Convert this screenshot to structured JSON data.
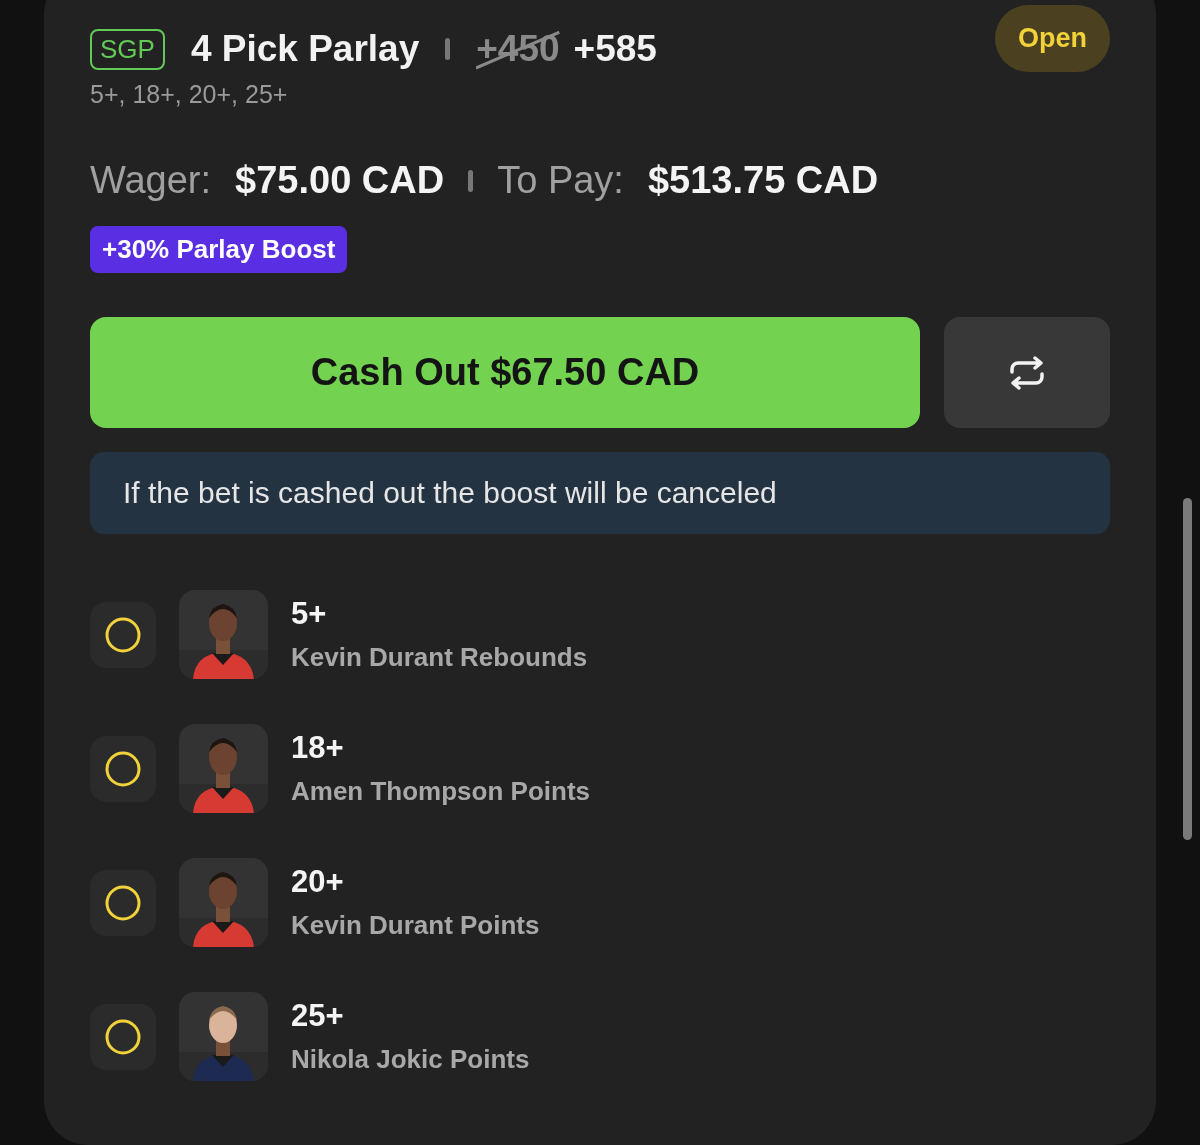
{
  "bet": {
    "badge": "SGP",
    "title": "4 Pick Parlay",
    "old_odds": "+450",
    "odds": "+585",
    "status": "Open",
    "summary": "5+, 18+, 20+, 25+"
  },
  "amounts": [
    {
      "label": "Wager:",
      "value": "$75.00 CAD"
    },
    {
      "label": "To Pay:",
      "value": "$513.75 CAD"
    }
  ],
  "boost_tag": "+30% Parlay Boost",
  "cash_out_button": "Cash Out $67.50 CAD",
  "notice": "If the bet is cashed out the boost will be canceled",
  "legs": [
    {
      "line": "5+",
      "market": "Kevin Durant Rebounds",
      "won": false
    },
    {
      "line": "18+",
      "market": "Amen Thompson Points",
      "won": false
    },
    {
      "line": "20+",
      "market": "Kevin Durant Points",
      "won": false
    },
    {
      "line": "25+",
      "market": "Nikola Jokic Points",
      "won": false
    }
  ]
}
